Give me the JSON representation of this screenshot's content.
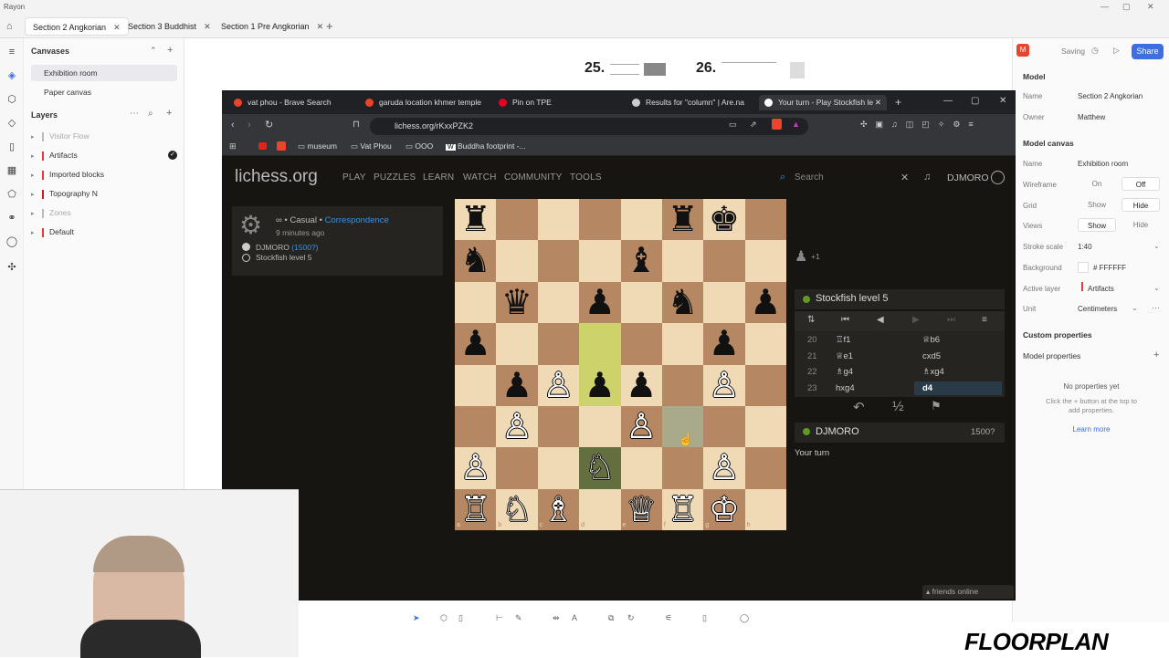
{
  "rayon": {
    "app_title": "Rayon",
    "tabs": [
      {
        "label": "Section 2 Angkorian"
      },
      {
        "label": "Section 3 Buddhist"
      },
      {
        "label": "Section 1 Pre Angkorian"
      }
    ],
    "add_tab": "+",
    "canvases": {
      "heading": "Canvases",
      "items": [
        "Exhibition room",
        "Paper canvas"
      ]
    },
    "layers": {
      "heading": "Layers",
      "items": [
        {
          "name": "Visitor Flow",
          "color": "#bbbbbb"
        },
        {
          "name": "Artifacts",
          "color": "#e33b3b"
        },
        {
          "name": "Imported blocks",
          "color": "#e33b3b"
        },
        {
          "name": "Topography N",
          "color": "#c0202a"
        },
        {
          "name": "Zones",
          "color": "#bbbbbb"
        },
        {
          "name": "Default",
          "color": "#e33b3b"
        }
      ]
    },
    "doc_numbers": [
      "25.",
      "26."
    ],
    "right": {
      "avatar": "M",
      "saving": "Saving",
      "share": "Share",
      "model_heading": "Model",
      "name_label": "Name",
      "name_value": "Section 2 Angkorian",
      "owner_label": "Owner",
      "owner_value": "Matthew",
      "canvas_heading": "Model canvas",
      "c_name_label": "Name",
      "c_name_value": "Exhibition room",
      "wireframe_label": "Wireframe",
      "wireframe_on": "On",
      "wireframe_off": "Off",
      "grid_label": "Grid",
      "grid_show": "Show",
      "grid_hide": "Hide",
      "views_label": "Views",
      "views_show": "Show",
      "views_hide": "Hide",
      "stroke_label": "Stroke scale",
      "stroke_value": "1:40",
      "bg_label": "Background",
      "bg_value": "# FFFFFF",
      "active_layer_label": "Active layer",
      "active_layer_value": "Artifacts",
      "unit_label": "Unit",
      "unit_value": "Centimeters",
      "custom_heading": "Custom properties",
      "model_props": "Model properties",
      "no_props": "No properties yet",
      "no_props_hint": "Click the + button at the top to add properties.",
      "learn_more": "Learn more"
    },
    "brand": "FLOORPLAN"
  },
  "browser": {
    "tabs": [
      {
        "label": "vat phou - Brave Search",
        "color": "#e8452c"
      },
      {
        "label": "garuda location khmer temple",
        "color": "#e8452c"
      },
      {
        "label": "Pin on TPE",
        "color": "#e60023"
      },
      {
        "label": "Results for \"column\" | Are.na",
        "color": "#cccccc"
      },
      {
        "label": "Your turn - Play Stockfish le",
        "color": "#ffffff"
      }
    ],
    "url": "lichess.org/rKxxPZK2",
    "bookmarks": [
      "museum",
      "Vat Phou",
      "OOO",
      "Buddha footprint -..."
    ]
  },
  "lichess": {
    "logo": "lichess.org",
    "nav": [
      "PLAY",
      "PUZZLES",
      "LEARN",
      "WATCH",
      "COMMUNITY",
      "TOOLS"
    ],
    "search_placeholder": "Search",
    "user": "DJMORO",
    "game": {
      "mode": "∞ • Casual •",
      "mode_link": "Correspondence",
      "time": "9 minutes ago",
      "white": "DJMORO",
      "white_rating": "(1500?)",
      "black": "Stockfish level 5"
    },
    "captured": "+1",
    "opponent": "Stockfish level 5",
    "moves": [
      {
        "n": "20",
        "w": "♖f1",
        "b": "♕b6"
      },
      {
        "n": "21",
        "w": "♕e1",
        "b": "cxd5"
      },
      {
        "n": "22",
        "w": "♗g4",
        "b": "♗xg4"
      },
      {
        "n": "23",
        "w": "hxg4",
        "b": "d4"
      }
    ],
    "player": "DJMORO",
    "player_rating": "1500?",
    "status": "Your turn",
    "half": "½",
    "friends": "friends online"
  },
  "board": {
    "files": [
      "a",
      "b",
      "c",
      "d",
      "e",
      "f",
      "g",
      "h"
    ],
    "pieces": [
      {
        "sq": "a8",
        "p": "♜",
        "c": "b"
      },
      {
        "sq": "f8",
        "p": "♜",
        "c": "b"
      },
      {
        "sq": "g8",
        "p": "♚",
        "c": "b"
      },
      {
        "sq": "a7",
        "p": "♞",
        "c": "b"
      },
      {
        "sq": "e7",
        "p": "♝",
        "c": "b"
      },
      {
        "sq": "b6",
        "p": "♛",
        "c": "b"
      },
      {
        "sq": "d6",
        "p": "♟",
        "c": "b"
      },
      {
        "sq": "f6",
        "p": "♞",
        "c": "b"
      },
      {
        "sq": "h6",
        "p": "♟",
        "c": "b"
      },
      {
        "sq": "a5",
        "p": "♟",
        "c": "b"
      },
      {
        "sq": "g5",
        "p": "♟",
        "c": "b"
      },
      {
        "sq": "b4",
        "p": "♟",
        "c": "b"
      },
      {
        "sq": "c4",
        "p": "♙",
        "c": "w"
      },
      {
        "sq": "d4",
        "p": "♟",
        "c": "b"
      },
      {
        "sq": "e4",
        "p": "♟",
        "c": "b"
      },
      {
        "sq": "g4",
        "p": "♙",
        "c": "w"
      },
      {
        "sq": "b3",
        "p": "♙",
        "c": "w"
      },
      {
        "sq": "e3",
        "p": "♙",
        "c": "w"
      },
      {
        "sq": "a2",
        "p": "♙",
        "c": "w"
      },
      {
        "sq": "d2",
        "p": "♘",
        "c": "w"
      },
      {
        "sq": "g2",
        "p": "♙",
        "c": "w"
      },
      {
        "sq": "a1",
        "p": "♖",
        "c": "w"
      },
      {
        "sq": "b1",
        "p": "♘",
        "c": "w"
      },
      {
        "sq": "c1",
        "p": "♗",
        "c": "w"
      },
      {
        "sq": "e1",
        "p": "♕",
        "c": "w"
      },
      {
        "sq": "f1",
        "p": "♖",
        "c": "w"
      },
      {
        "sq": "g1",
        "p": "♔",
        "c": "w"
      }
    ],
    "last_move": [
      "d5",
      "d4"
    ],
    "selected": "d2",
    "target": "f3"
  },
  "colors": {
    "light": "#f0d9b5",
    "dark": "#b58863",
    "lastmove": "#cdd26a",
    "selected": "#646f40",
    "accent": "#3692e7",
    "green": "#629924"
  }
}
